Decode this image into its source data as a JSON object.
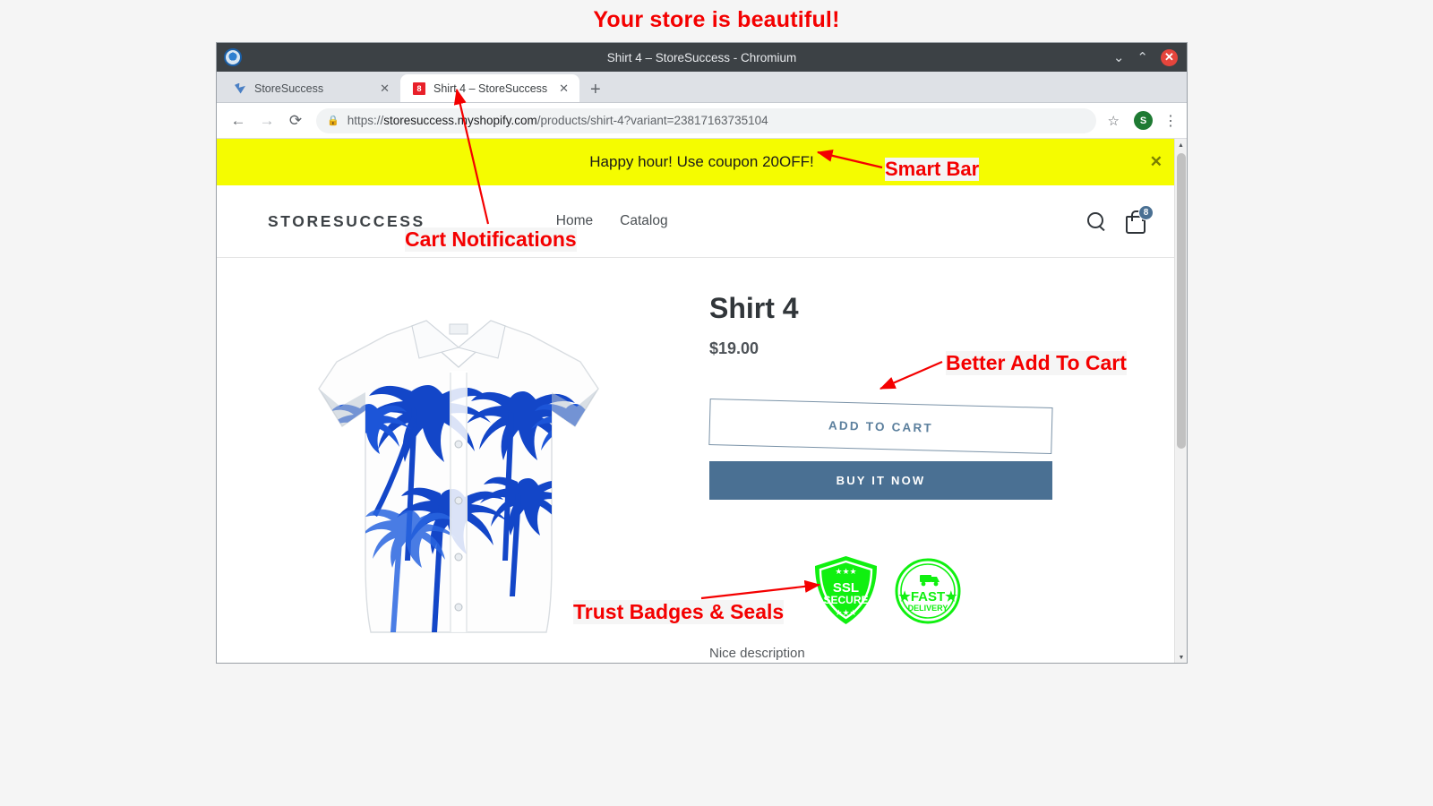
{
  "annotations": {
    "headline": "Your store is beautiful!",
    "smart_bar": "Smart Bar",
    "cart_notifications": "Cart Notifications",
    "better_add_to_cart": "Better Add To Cart",
    "trust_badges": "Trust Badges & Seals",
    "color": "#f40000"
  },
  "browser": {
    "window_title": "Shirt 4 – StoreSuccess - Chromium",
    "minimize_label": "⌄",
    "maximize_label": "⌃",
    "close_label": "✕",
    "tabs": [
      {
        "label": "StoreSuccess",
        "favicon": "storesuccess-logo-icon",
        "active": false,
        "close_label": "✕"
      },
      {
        "label": "Shirt 4 – StoreSuccess",
        "favicon": "cart-count-badge-icon",
        "favicon_text": "8",
        "active": true,
        "close_label": "✕"
      }
    ],
    "new_tab_label": "+",
    "nav": {
      "back_label": "←",
      "forward_label": "→",
      "reload_label": "⟳",
      "lock_icon": "lock-icon",
      "bookmark_label": "☆",
      "profile_initial": "S",
      "menu_label": "⋮"
    },
    "url": {
      "scheme": "https://",
      "domain": "storesuccess.myshopify.com",
      "path": "/products/shirt-4?variant=23817163735104",
      "full": "https://storesuccess.myshopify.com/products/shirt-4?variant=23817163735104"
    }
  },
  "smart_bar": {
    "message": "Happy hour! Use coupon 20OFF!",
    "close_label": "✕",
    "background": "#f5fc00"
  },
  "store_header": {
    "logo": "STORESUCCESS",
    "nav_items": [
      {
        "label": "Home"
      },
      {
        "label": "Catalog"
      }
    ],
    "search_icon": "search-icon",
    "cart_icon": "shopping-bag-icon",
    "cart_count": "8",
    "cart_badge_color": "#4a7093"
  },
  "product": {
    "title": "Shirt 4",
    "price": "$19.00",
    "add_to_cart_label": "ADD TO CART",
    "buy_now_label": "BUY IT NOW",
    "image_alt": "white hawaiian shirt with blue palm trees",
    "description": "Nice description",
    "trust_badges": [
      {
        "name": "ssl-secure-badge",
        "line1": "SSL",
        "line2": "SECURE",
        "color": "#10f010"
      },
      {
        "name": "fast-delivery-badge",
        "line1": "FAST",
        "line2": "DELIVERY",
        "color": "#10f010"
      }
    ]
  },
  "scrollbar": {
    "up_label": "▲",
    "down_label": "▼"
  }
}
